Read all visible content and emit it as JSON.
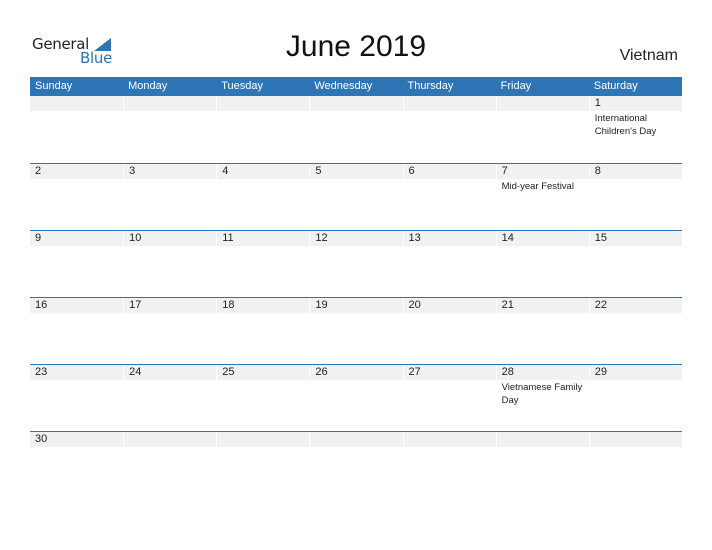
{
  "logo": {
    "word1": "General",
    "word2": "Blue",
    "icon": "triangle-flag-icon",
    "color": "#2e75b6"
  },
  "title": "June 2019",
  "country": "Vietnam",
  "header_color": "#2e75b6",
  "weekdays": [
    "Sunday",
    "Monday",
    "Tuesday",
    "Wednesday",
    "Thursday",
    "Friday",
    "Saturday"
  ],
  "weeks": [
    {
      "days": [
        {
          "num": "",
          "event": ""
        },
        {
          "num": "",
          "event": ""
        },
        {
          "num": "",
          "event": ""
        },
        {
          "num": "",
          "event": ""
        },
        {
          "num": "",
          "event": ""
        },
        {
          "num": "",
          "event": ""
        },
        {
          "num": "1",
          "event": "International Children's Day"
        }
      ]
    },
    {
      "days": [
        {
          "num": "2",
          "event": ""
        },
        {
          "num": "3",
          "event": ""
        },
        {
          "num": "4",
          "event": ""
        },
        {
          "num": "5",
          "event": ""
        },
        {
          "num": "6",
          "event": ""
        },
        {
          "num": "7",
          "event": "Mid-year Festival"
        },
        {
          "num": "8",
          "event": ""
        }
      ]
    },
    {
      "days": [
        {
          "num": "9",
          "event": ""
        },
        {
          "num": "10",
          "event": ""
        },
        {
          "num": "11",
          "event": ""
        },
        {
          "num": "12",
          "event": ""
        },
        {
          "num": "13",
          "event": ""
        },
        {
          "num": "14",
          "event": ""
        },
        {
          "num": "15",
          "event": ""
        }
      ]
    },
    {
      "days": [
        {
          "num": "16",
          "event": ""
        },
        {
          "num": "17",
          "event": ""
        },
        {
          "num": "18",
          "event": ""
        },
        {
          "num": "19",
          "event": ""
        },
        {
          "num": "20",
          "event": ""
        },
        {
          "num": "21",
          "event": ""
        },
        {
          "num": "22",
          "event": ""
        }
      ]
    },
    {
      "days": [
        {
          "num": "23",
          "event": ""
        },
        {
          "num": "24",
          "event": ""
        },
        {
          "num": "25",
          "event": ""
        },
        {
          "num": "26",
          "event": ""
        },
        {
          "num": "27",
          "event": ""
        },
        {
          "num": "28",
          "event": "Vietnamese Family Day"
        },
        {
          "num": "29",
          "event": ""
        }
      ]
    },
    {
      "days": [
        {
          "num": "30",
          "event": ""
        },
        {
          "num": "",
          "event": ""
        },
        {
          "num": "",
          "event": ""
        },
        {
          "num": "",
          "event": ""
        },
        {
          "num": "",
          "event": ""
        },
        {
          "num": "",
          "event": ""
        },
        {
          "num": "",
          "event": ""
        }
      ]
    }
  ]
}
